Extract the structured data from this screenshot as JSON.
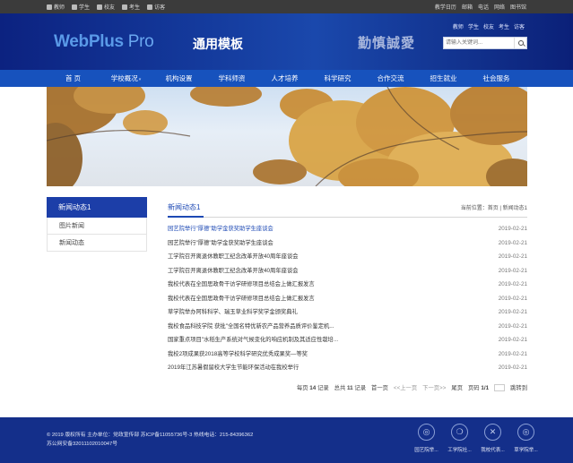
{
  "topbar": {
    "left": [
      {
        "label": "教师",
        "icon": "teacher-icon"
      },
      {
        "label": "学生",
        "icon": "student-icon"
      },
      {
        "label": "校友",
        "icon": "alumni-icon"
      },
      {
        "label": "考生",
        "icon": "examinee-icon"
      },
      {
        "label": "访客",
        "icon": "visitor-icon"
      }
    ],
    "right": [
      "教学日历",
      "邮箱",
      "电话",
      "网络",
      "图书馆"
    ]
  },
  "header": {
    "quick_links": [
      "教师",
      "学生",
      "校友",
      "考生",
      "访客"
    ],
    "logo_main": "WebPlus",
    "logo_pro": " Pro",
    "subtitle": "通用模板",
    "motto": "勤慎誠愛",
    "search_placeholder": "请输入关键词..."
  },
  "nav": [
    {
      "label": "首 页",
      "dropdown": false
    },
    {
      "label": "学校概况",
      "dropdown": true
    },
    {
      "label": "机构设置",
      "dropdown": false
    },
    {
      "label": "学科师资",
      "dropdown": false
    },
    {
      "label": "人才培养",
      "dropdown": false
    },
    {
      "label": "科学研究",
      "dropdown": false
    },
    {
      "label": "合作交流",
      "dropdown": false
    },
    {
      "label": "招生就业",
      "dropdown": false
    },
    {
      "label": "社会服务",
      "dropdown": false
    }
  ],
  "sidebar": {
    "title": "新闻动态1",
    "items": [
      "图片新闻",
      "新闻动态"
    ]
  },
  "main": {
    "title": "新闻动态1",
    "breadcrumb": "当前位置：首页 | 新闻动态1",
    "news": [
      {
        "title": "园艺院举行\"厚德\"助学金获奖助学生座谈会",
        "date": "2019-02-21"
      },
      {
        "title": "园艺院举行\"厚德\"助学金获奖助学生座谈会",
        "date": "2019-02-21"
      },
      {
        "title": "工学院召开离退休教职工纪念改革开放40周年座谈会",
        "date": "2019-02-21"
      },
      {
        "title": "工学院召开离退休教职工纪念改革开放40周年座谈会",
        "date": "2019-02-21"
      },
      {
        "title": "我校代表在全国思政骨干访学研修项目总结会上做汇报发言",
        "date": "2019-02-21"
      },
      {
        "title": "我校代表在全国思政骨干访学研修项目总结会上做汇报发言",
        "date": "2019-02-21"
      },
      {
        "title": "草学院举办阿科科学、瑞玉草业科学奖学金颁奖典礼",
        "date": "2019-02-21"
      },
      {
        "title": "我校食品科技学院 获批\"全国名特优新农产品营养品质评价鉴定机...",
        "date": "2019-02-21"
      },
      {
        "title": "国家重点项目\"水稻生产系统对气候变化的响应机制及其适应性栽培...",
        "date": "2019-02-21"
      },
      {
        "title": "我校2项成果获2018高等学校科学研究优秀成果奖—等奖",
        "date": "2019-02-21"
      },
      {
        "title": "2019年江苏暑假留校大学生节能环保活动在我校举行",
        "date": "2019-02-21"
      }
    ],
    "pager": {
      "per_page_label": "每页",
      "per_page": "14",
      "records_label": "记录",
      "total_label": "总共",
      "total": "11",
      "first": "首一页",
      "prev": "<<上一页",
      "next": "下一页>>",
      "last": "尾页",
      "page_label": "页码",
      "page": "1/1",
      "goto": "跳转到"
    }
  },
  "footer": {
    "line1": "© 2019 版权所有  主办单位：党政宣传部  苏ICP备11055736号-3  热线电话：215-84396362",
    "line2": "苏公网安备32011102010047号",
    "icons": [
      {
        "label": "园艺院举...",
        "icon": "weibo-icon",
        "glyph": "◎"
      },
      {
        "label": "工学院社...",
        "icon": "wechat-icon",
        "glyph": "❍"
      },
      {
        "label": "我校代表...",
        "icon": "tools-icon",
        "glyph": "✕"
      },
      {
        "label": "草学院举...",
        "icon": "weibo-icon",
        "glyph": "◎"
      }
    ]
  }
}
